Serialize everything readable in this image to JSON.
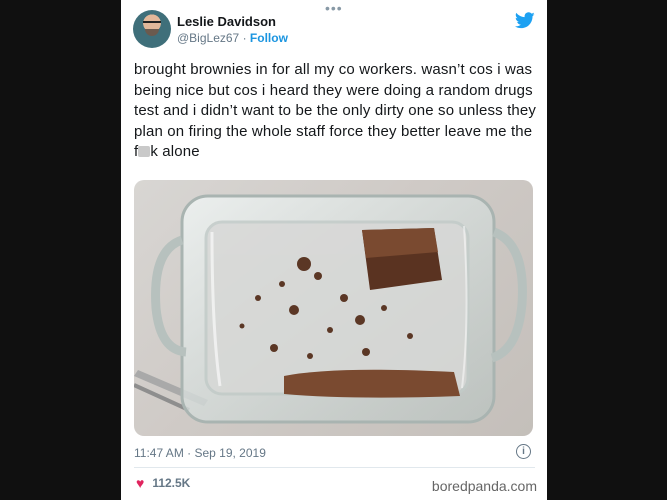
{
  "tweet": {
    "more_dots": "•••",
    "author_name": "Leslie Davidson",
    "handle": "@BigLez67",
    "separator": " · ",
    "follow_label": "Follow",
    "text_before": "brought brownies in for all my co workers. wasn’t cos i was being nice but cos i heard they were doing a random drugs test and i didn’t want to be the only dirty one so unless they plan on firing the whole staff force they better leave me the f",
    "text_after": "k alone",
    "timestamp": "11:47 AM · Sep 19, 2019",
    "likes": "112.5K"
  },
  "icons": {
    "brand": "twitter-bird-icon",
    "info": "info-icon",
    "like": "heart-icon"
  },
  "colors": {
    "link": "#1b95e0",
    "heart": "#e0245e",
    "muted": "#657786"
  },
  "watermark": "boredpanda.com"
}
